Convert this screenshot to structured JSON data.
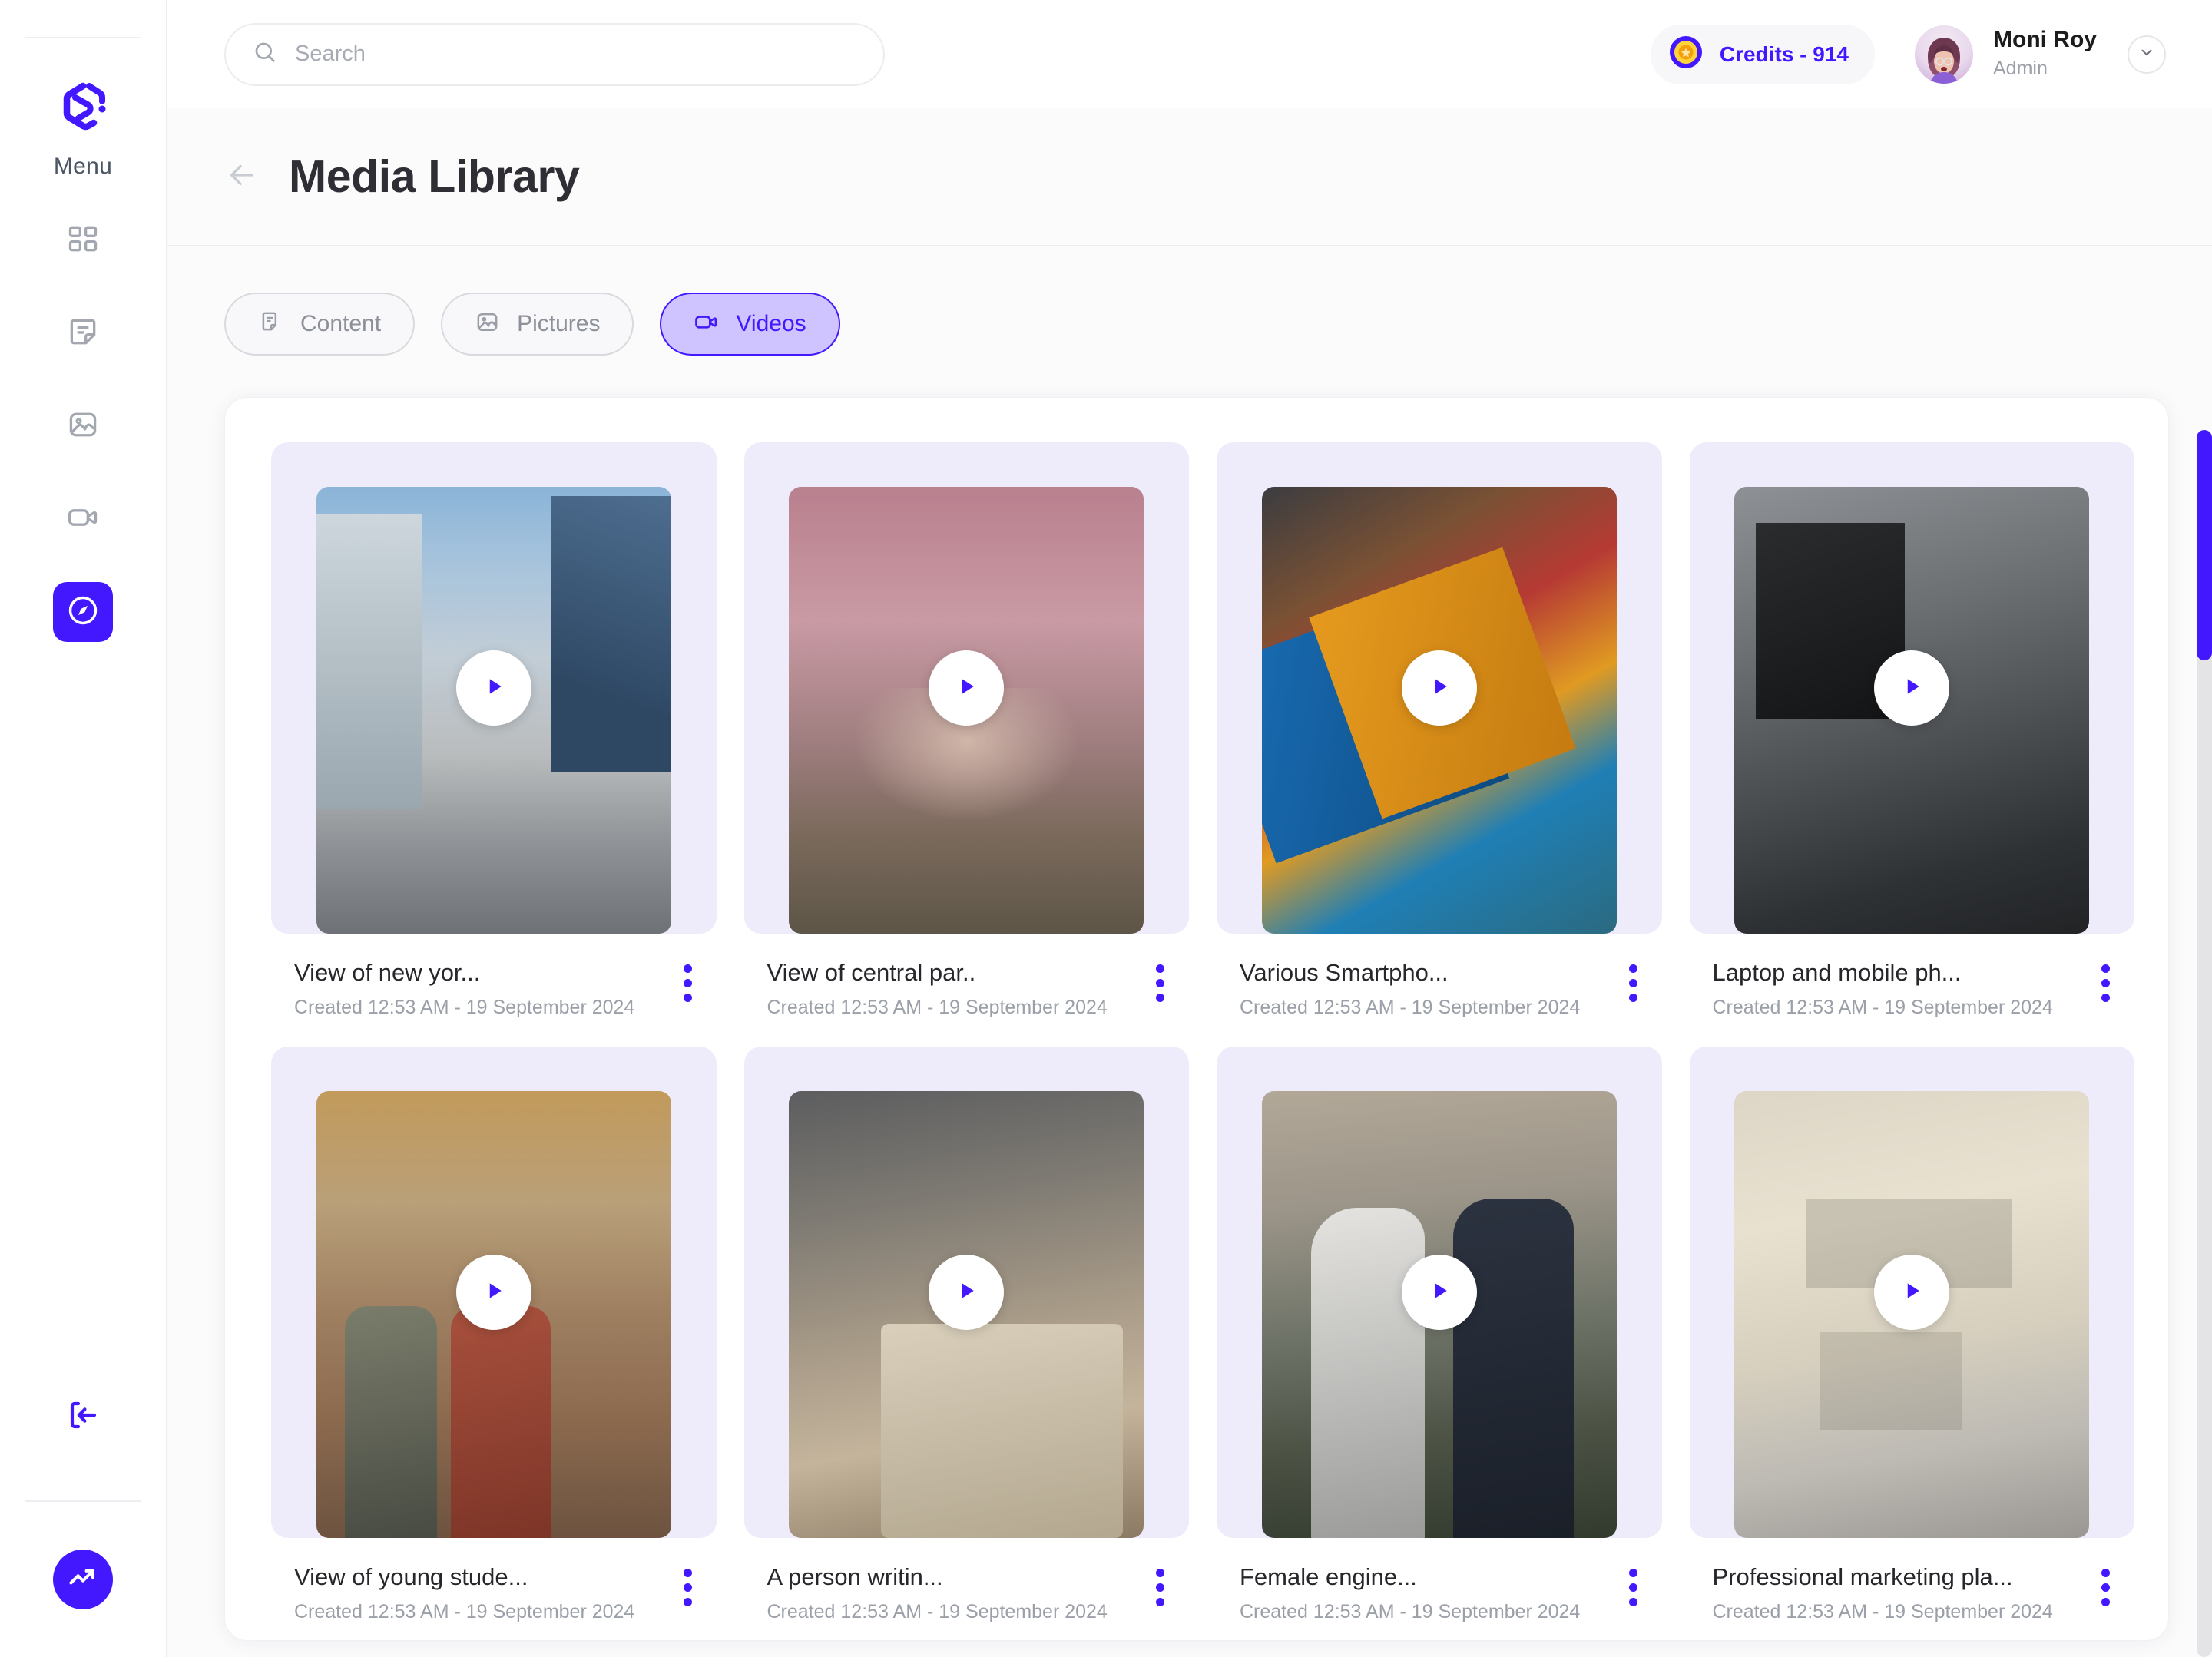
{
  "sidebar": {
    "menu_label": "Menu",
    "logo_name": "brand-logo",
    "items": [
      {
        "icon": "grid-icon",
        "name": "dashboard",
        "active": false
      },
      {
        "icon": "note-icon",
        "name": "content",
        "active": false
      },
      {
        "icon": "image-icon",
        "name": "pictures",
        "active": false
      },
      {
        "icon": "video-icon",
        "name": "videos",
        "active": false
      },
      {
        "icon": "compass-icon",
        "name": "explore",
        "active": true
      }
    ],
    "logout_icon": "logout-icon",
    "fab_icon": "trending-up-icon"
  },
  "topbar": {
    "search": {
      "placeholder": "Search",
      "value": "",
      "icon": "search-icon"
    },
    "credits": {
      "label": "Credits - 914",
      "icon": "coin-icon"
    },
    "profile": {
      "name": "Moni Roy",
      "role": "Admin",
      "chevron": "chevron-down-icon",
      "avatar": "user-avatar"
    }
  },
  "page": {
    "back_icon": "arrow-left-icon",
    "title": "Media Library"
  },
  "tabs": [
    {
      "label": "Content",
      "icon": "document-icon",
      "active": false
    },
    {
      "label": "Pictures",
      "icon": "image-icon",
      "active": false
    },
    {
      "label": "Videos",
      "icon": "video-icon",
      "active": true
    }
  ],
  "cards": [
    {
      "title": "View of new yor...",
      "subtitle": "Created 12:53 AM - 19 September 2024",
      "art": "a-city"
    },
    {
      "title": "View of central par..",
      "subtitle": "Created 12:53 AM - 19 September 2024",
      "art": "a-blossom"
    },
    {
      "title": "Various Smartpho...",
      "subtitle": "Created 12:53 AM - 19 September 2024",
      "art": "a-phones"
    },
    {
      "title": "Laptop and mobile ph...",
      "subtitle": "Created 12:53 AM - 19 September 2024",
      "art": "a-laptop"
    },
    {
      "title": "View of young stude...",
      "subtitle": "Created 12:53 AM - 19 September 2024",
      "art": "a-school"
    },
    {
      "title": "A person writin...",
      "subtitle": "Created 12:53 AM - 19 September 2024",
      "art": "a-writing"
    },
    {
      "title": "Female engine...",
      "subtitle": "Created 12:53 AM - 19 September 2024",
      "art": "a-engineer"
    },
    {
      "title": "Professional marketing pla...",
      "subtitle": "Created 12:53 AM - 19 September 2024",
      "art": "a-marketing"
    }
  ],
  "colors": {
    "accent": "#4318ff",
    "accent_soft": "#cfc4ff",
    "card_bg": "#eeecfa",
    "text_primary": "#26262b",
    "text_muted": "#9ba0a8"
  }
}
